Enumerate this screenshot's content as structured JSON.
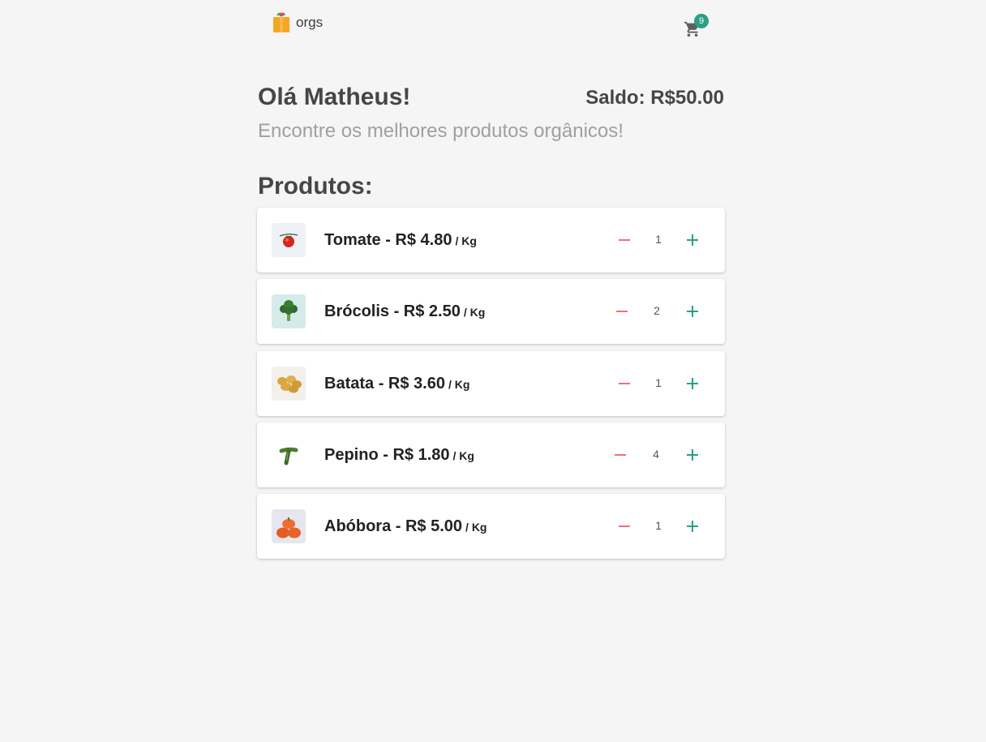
{
  "header": {
    "logo_text": "orgs",
    "cart_count": "9",
    "accent_color": "#2a9f85"
  },
  "intro": {
    "greeting": "Olá Matheus!",
    "balance": "Saldo: R$50.00",
    "subtitle": "Encontre os melhores produtos orgânicos!"
  },
  "products_title": "Produtos:",
  "products": [
    {
      "name": "Tomate - R$ 4.80",
      "unit": "/ Kg",
      "quantity": "1",
      "icon": "tomato-icon"
    },
    {
      "name": "Brócolis - R$ 2.50",
      "unit": "/ Kg",
      "quantity": "2",
      "icon": "broccoli-icon"
    },
    {
      "name": "Batata - R$ 3.60",
      "unit": "/ Kg",
      "quantity": "1",
      "icon": "potato-icon"
    },
    {
      "name": "Pepino - R$ 1.80",
      "unit": "/ Kg",
      "quantity": "4",
      "icon": "cucumber-icon"
    },
    {
      "name": "Abóbora - R$ 5.00",
      "unit": "/ Kg",
      "quantity": "1",
      "icon": "pumpkin-icon"
    }
  ]
}
